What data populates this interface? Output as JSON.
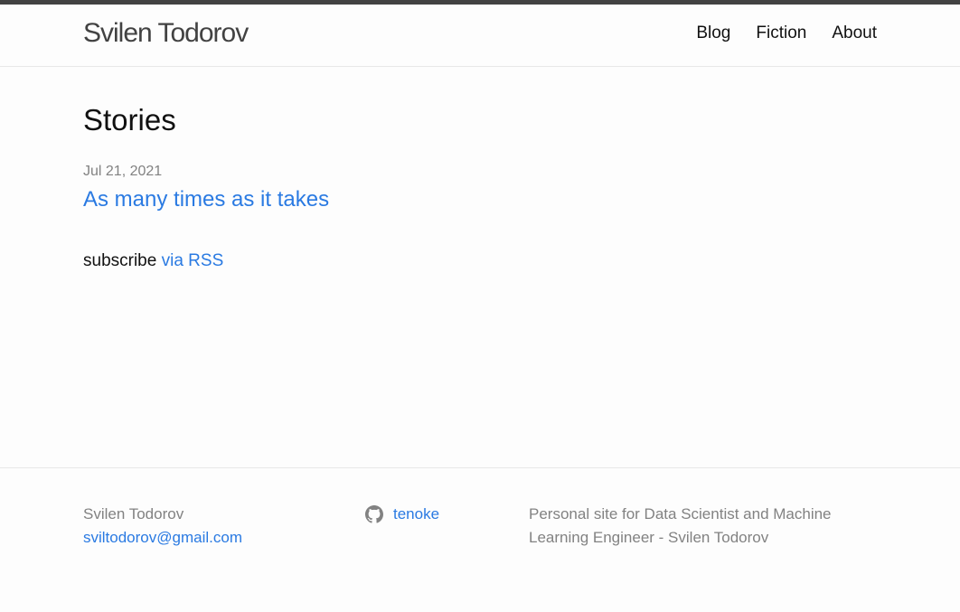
{
  "header": {
    "site_title": "Svilen Todorov",
    "nav": [
      {
        "label": "Blog"
      },
      {
        "label": "Fiction"
      },
      {
        "label": "About"
      }
    ]
  },
  "main": {
    "heading": "Stories",
    "posts": [
      {
        "date": "Jul 21, 2021",
        "title": "As many times as it takes"
      }
    ],
    "rss": {
      "prefix": "subscribe",
      "link_label": "via RSS"
    }
  },
  "footer": {
    "name": "Svilen Todorov",
    "email": "sviltodorov@gmail.com",
    "github": {
      "icon": "github-icon",
      "username": "tenoke"
    },
    "description": "Personal site for Data Scientist and Machine Learning Engineer - Svilen Todorov"
  },
  "colors": {
    "top_bar": "#424242",
    "link": "#2a7ae2",
    "muted": "#828282",
    "background": "#fdfdfd"
  }
}
